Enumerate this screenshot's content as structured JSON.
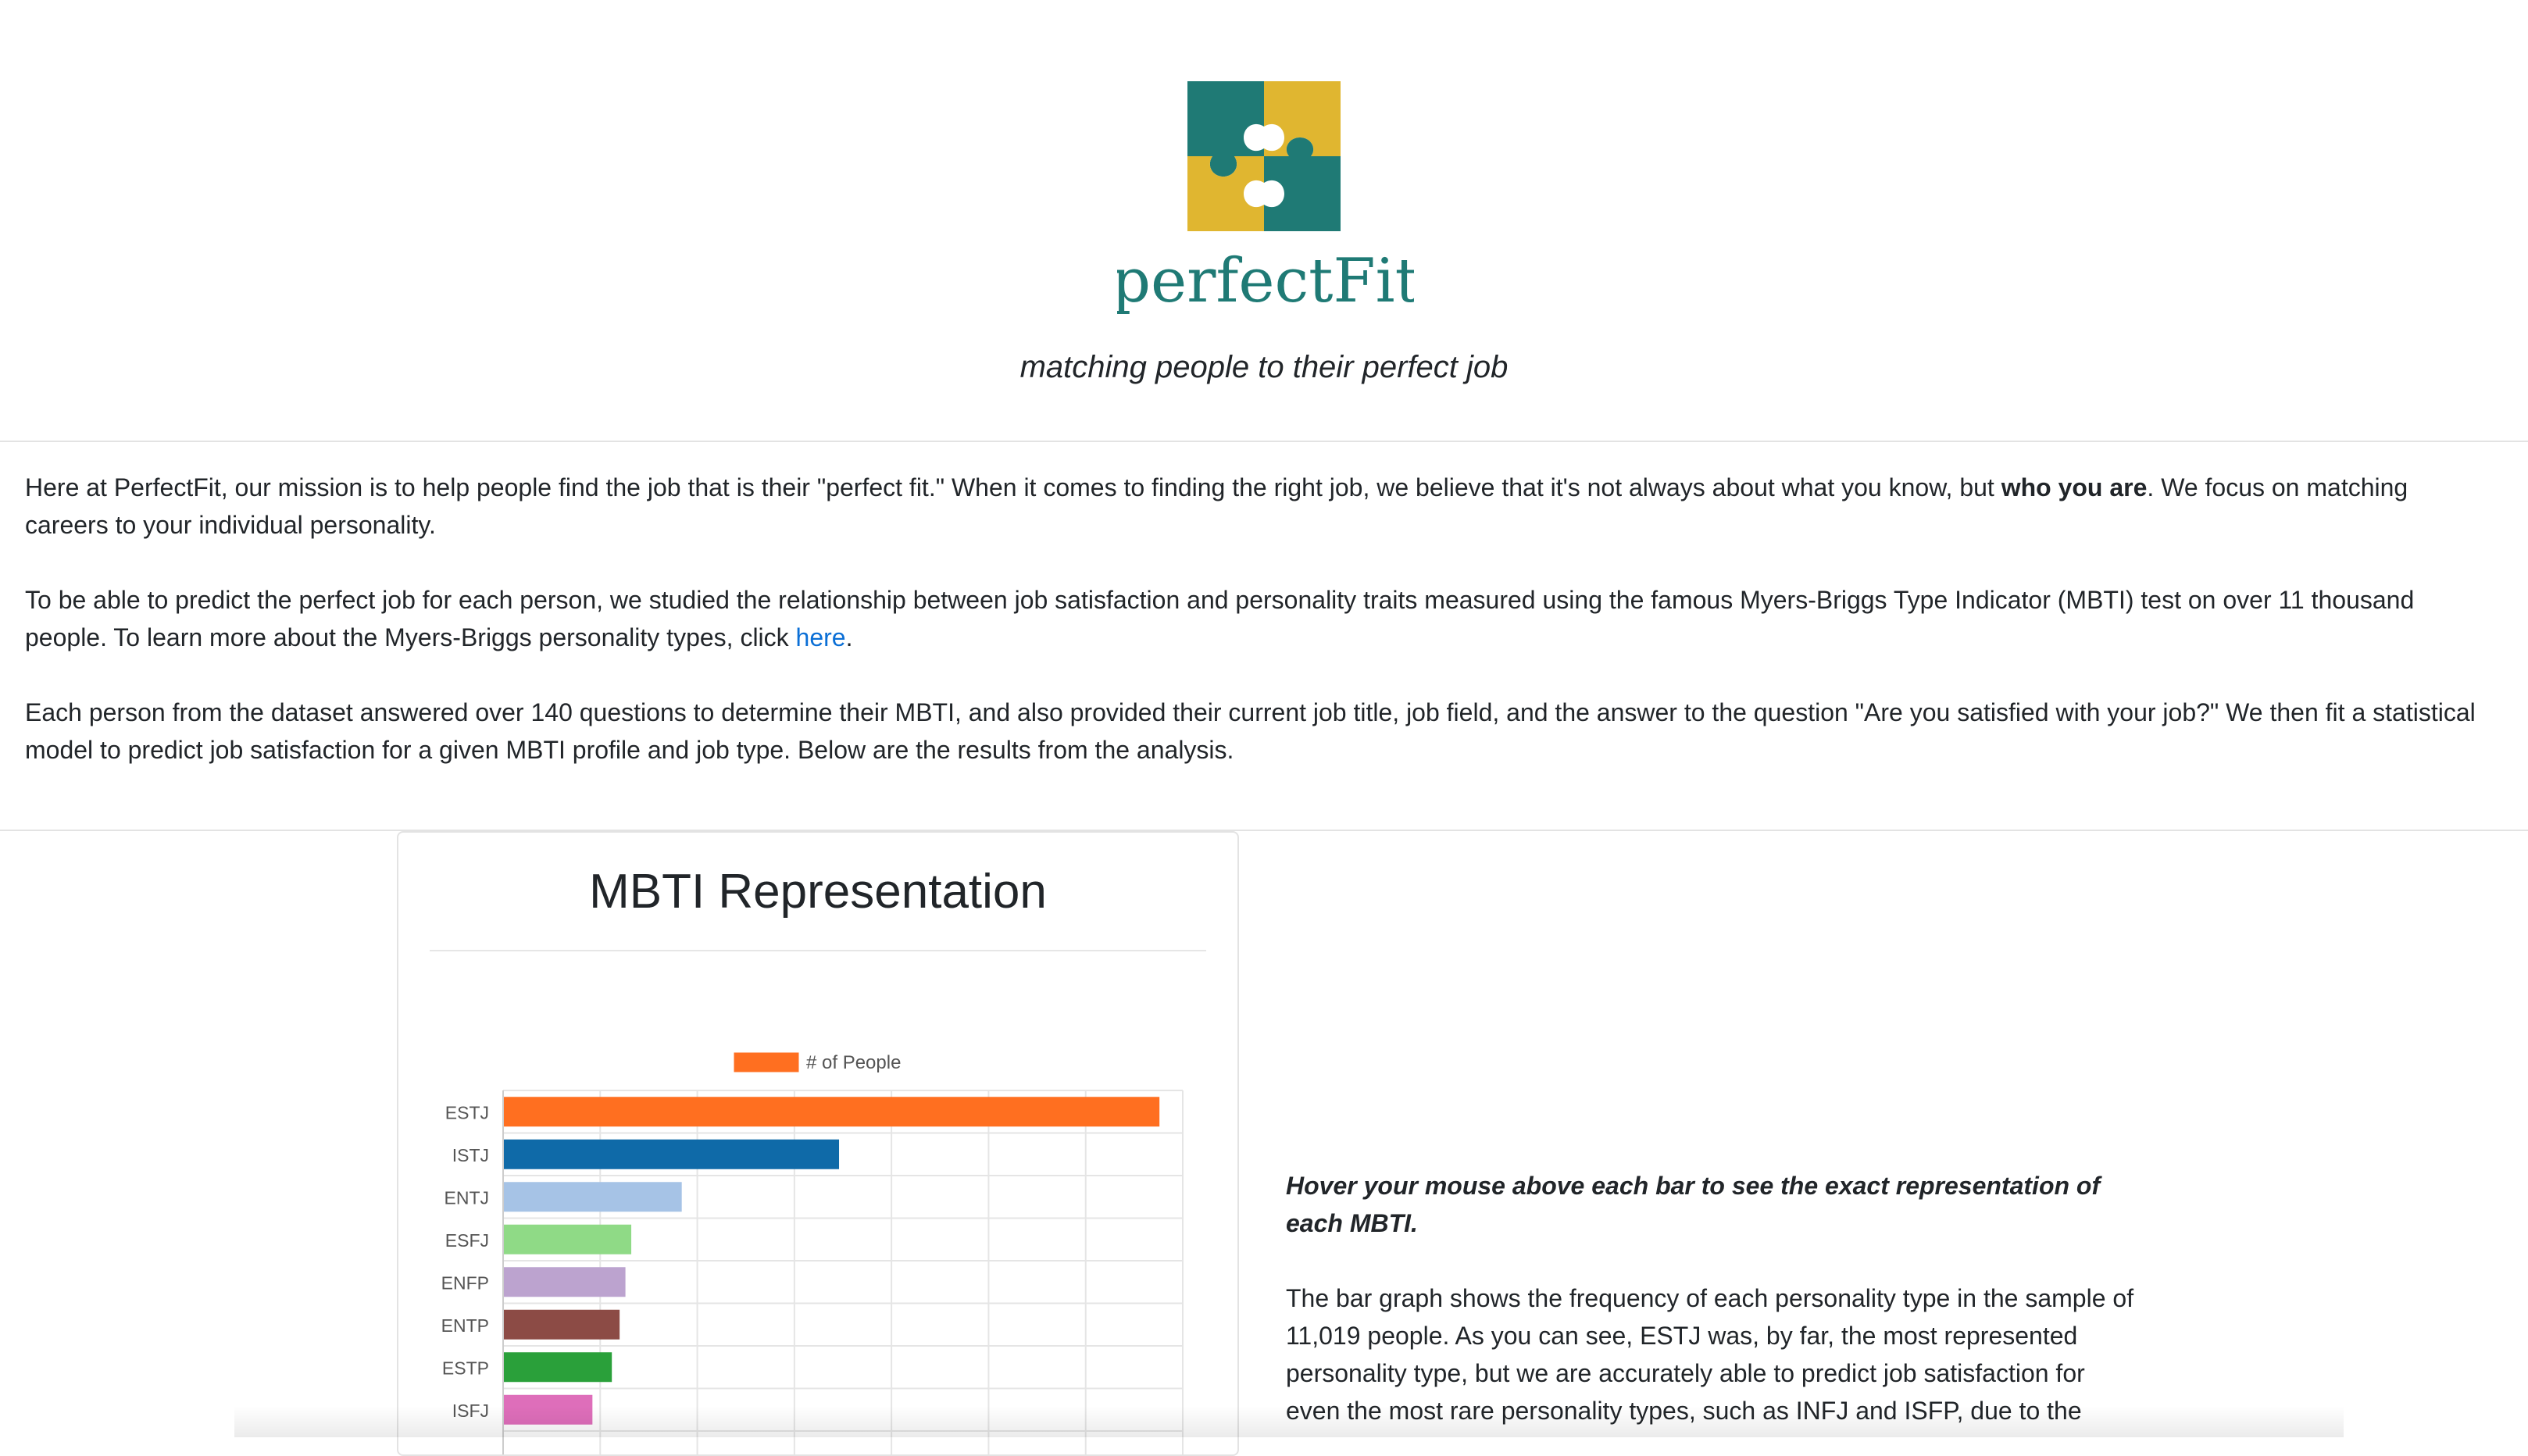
{
  "brand": {
    "logo_text": "perfectFit",
    "tagline": "matching people to their perfect job",
    "colors": {
      "teal": "#1f7a75",
      "gold": "#e0b630"
    }
  },
  "intro": {
    "p1_before": "Here at PerfectFit, our mission is to help people find the job that is their \"perfect fit.\" When it comes to finding the right job, we believe that it's not always about what you know, but ",
    "p1_bold": "who you are",
    "p1_after": ". We focus on matching careers to your individual personality.",
    "p2_before": "To be able to predict the perfect job for each person, we studied the relationship between job satisfaction and personality traits measured using the famous Myers-Briggs Type Indicator (MBTI) test on over 11 thousand people. To learn more about the Myers-Briggs personality types, click ",
    "p2_link": "here",
    "p2_after": ".",
    "p3": "Each person from the dataset answered over 140 questions to determine their MBTI, and also provided their current job title, job field, and the answer to the question \"Are you satisfied with your job?\" We then fit a statistical model to predict job satisfaction for a given MBTI profile and job type. Below are the results from the analysis."
  },
  "card": {
    "title": "MBTI Representation"
  },
  "chart_data": {
    "type": "bar",
    "orientation": "horizontal",
    "title": "",
    "legend": [
      "# of People"
    ],
    "legend_position": "top",
    "grid": true,
    "xlim": [
      0,
      3500
    ],
    "categories": [
      "ESTJ",
      "ISTJ",
      "ENTJ",
      "ESFJ",
      "ENFP",
      "ENTP",
      "ESTP",
      "ISFJ"
    ],
    "series": [
      {
        "name": "# of People",
        "values": [
          3380,
          1730,
          920,
          660,
          630,
          600,
          560,
          460
        ],
        "colors": [
          "#ff6f20",
          "#0f6aa8",
          "#a6c3e6",
          "#8fda86",
          "#bca3cf",
          "#8c4b45",
          "#2aa03a",
          "#de6eba"
        ]
      }
    ]
  },
  "side": {
    "hint": "Hover your mouse above each bar to see the exact representation of each MBTI.",
    "body": "The bar graph shows the frequency of each personality type in the sample of 11,019 people. As you can see, ESTJ was, by far, the most represented personality type, but we are accurately able to predict job satisfaction for even the most rare personality types, such as INFJ and ISFP, due to the"
  }
}
